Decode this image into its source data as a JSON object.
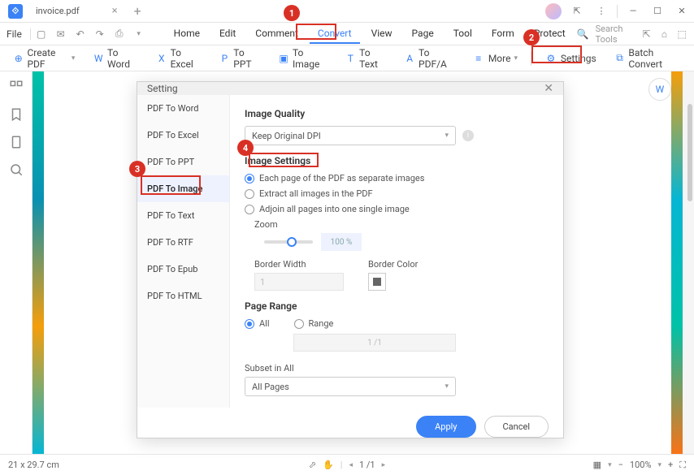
{
  "titlebar": {
    "filename": "invoice.pdf"
  },
  "menubar": {
    "file": "File",
    "tabs": [
      "Home",
      "Edit",
      "Comment",
      "Convert",
      "View",
      "Page",
      "Tool",
      "Form",
      "Protect"
    ],
    "active_tab": "Convert",
    "search_placeholder": "Search Tools"
  },
  "toolbar": {
    "create": "Create PDF",
    "to_word": "To Word",
    "to_excel": "To Excel",
    "to_ppt": "To PPT",
    "to_image": "To Image",
    "to_text": "To Text",
    "to_pdfa": "To PDF/A",
    "more": "More",
    "settings": "Settings",
    "batch": "Batch Convert"
  },
  "dialog": {
    "title": "Setting",
    "side_items": [
      "PDF To Word",
      "PDF To Excel",
      "PDF To PPT",
      "PDF To Image",
      "PDF To Text",
      "PDF To RTF",
      "PDF To Epub",
      "PDF To HTML"
    ],
    "active_side": "PDF To Image",
    "image_quality": {
      "title": "Image Quality",
      "value": "Keep Original DPI"
    },
    "image_settings": {
      "title": "Image Settings",
      "opt1": "Each page of the PDF as separate images",
      "opt2": "Extract all images in the PDF",
      "opt3": "Adjoin all pages into one single image",
      "zoom_label": "Zoom",
      "zoom_value": "100 %",
      "border_width_label": "Border Width",
      "border_width_value": "1",
      "border_color_label": "Border Color"
    },
    "page_range": {
      "title": "Page Range",
      "all": "All",
      "range": "Range",
      "range_value": "1 /1",
      "subset_label": "Subset in All",
      "subset_value": "All Pages"
    },
    "apply": "Apply",
    "cancel": "Cancel"
  },
  "statusbar": {
    "dims": "21 x 29.7 cm",
    "page": "1 /1",
    "zoom": "100%"
  },
  "annotations": {
    "b1": "1",
    "b2": "2",
    "b3": "3",
    "b4": "4"
  }
}
